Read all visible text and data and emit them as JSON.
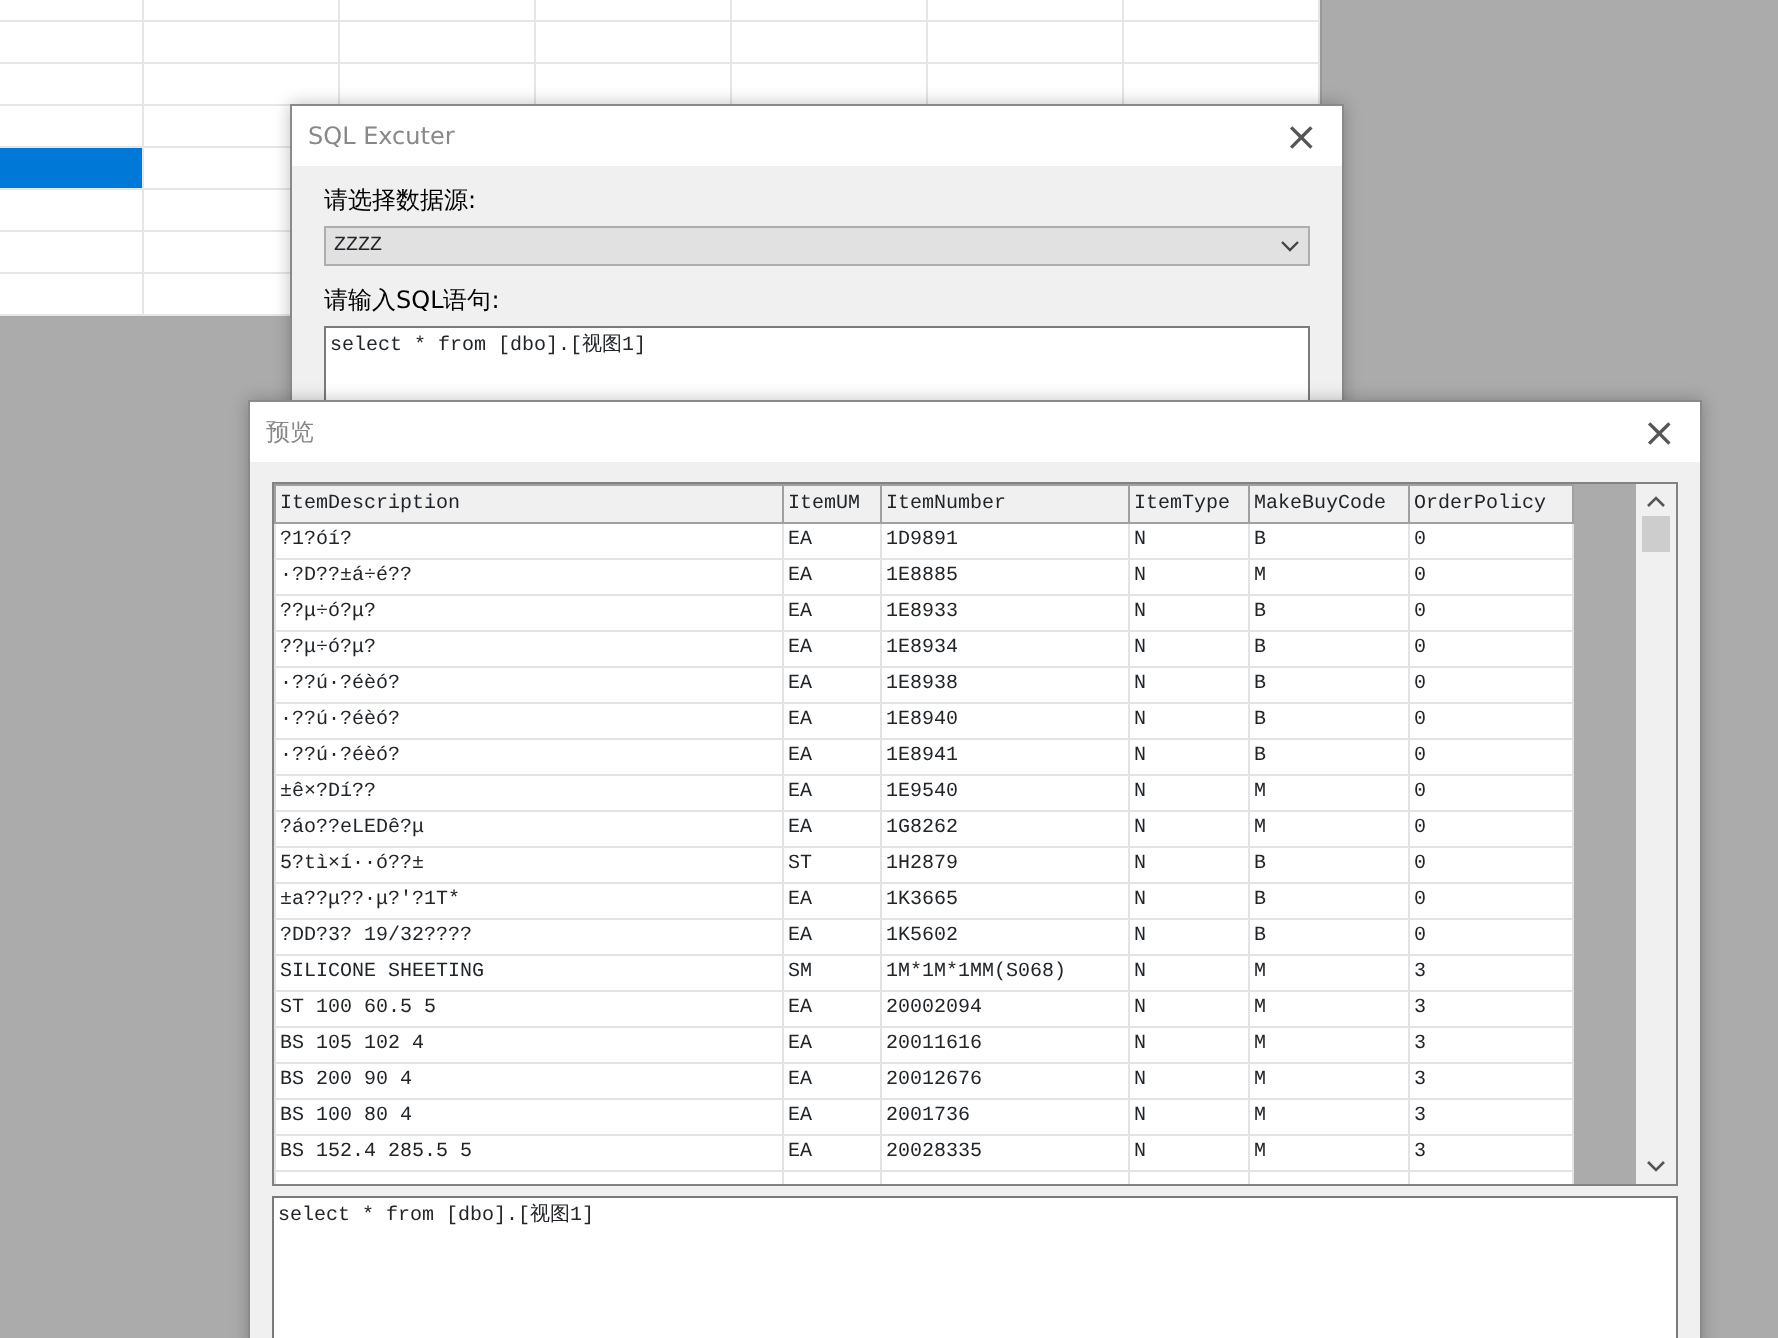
{
  "background_sheet": {
    "rows": [
      {
        "selected": false
      },
      {
        "selected": false
      },
      {
        "selected": false
      },
      {
        "selected": false
      },
      {
        "selected": true
      },
      {
        "selected": false
      },
      {
        "selected": false
      },
      {
        "selected": false
      }
    ]
  },
  "sql_dialog": {
    "title": "SQL Excuter",
    "close": "×",
    "source_label": "请选择数据源:",
    "source_value": "ZZZZ",
    "sql_label": "请输入SQL语句:",
    "sql_text": "select * from [dbo].[视图1]"
  },
  "preview_window": {
    "title": "预览",
    "close": "×",
    "table": {
      "columns": [
        "ItemDescription",
        "ItemUM",
        "ItemNumber",
        "ItemType",
        "MakeBuyCode",
        "OrderPolicy"
      ],
      "rows": [
        [
          "?1?óí?",
          "EA",
          "1D9891",
          "N",
          "B",
          "0"
        ],
        [
          "·?D??±á÷é??",
          "EA",
          "1E8885",
          "N",
          "M",
          "0"
        ],
        [
          "??μ÷ó?μ?",
          "EA",
          "1E8933",
          "N",
          "B",
          "0"
        ],
        [
          "??μ÷ó?μ?",
          "EA",
          "1E8934",
          "N",
          "B",
          "0"
        ],
        [
          "·??ú·?éèó?",
          "EA",
          "1E8938",
          "N",
          "B",
          "0"
        ],
        [
          "·??ú·?éèó?",
          "EA",
          "1E8940",
          "N",
          "B",
          "0"
        ],
        [
          "·??ú·?éèó?",
          "EA",
          "1E8941",
          "N",
          "B",
          "0"
        ],
        [
          "±ê×?Dí??",
          "EA",
          "1E9540",
          "N",
          "M",
          "0"
        ],
        [
          "?áo??eLEDê?μ",
          "EA",
          "1G8262",
          "N",
          "M",
          "0"
        ],
        [
          "5?tì×í··ó??±",
          "ST",
          "1H2879",
          "N",
          "B",
          "0"
        ],
        [
          "±a??μ??·μ?′?1T*",
          "EA",
          "1K3665",
          "N",
          "B",
          "0"
        ],
        [
          "?DD?3? 19/32????",
          "EA",
          "1K5602",
          "N",
          "B",
          "0"
        ],
        [
          "SILICONE SHEETING",
          "SM",
          "1M*1M*1MM(S068)",
          "N",
          "M",
          "3"
        ],
        [
          "ST 100 60.5 5",
          "EA",
          "20002094",
          "N",
          "M",
          "3"
        ],
        [
          "BS 105 102 4",
          "EA",
          "20011616",
          "N",
          "M",
          "3"
        ],
        [
          "BS 200 90 4",
          "EA",
          "20012676",
          "N",
          "M",
          "3"
        ],
        [
          "BS 100 80 4",
          "EA",
          "2001736",
          "N",
          "M",
          "3"
        ],
        [
          "BS 152.4 285.5 5",
          "EA",
          "20028335",
          "N",
          "M",
          "3"
        ]
      ]
    },
    "sql_text": "select * from [dbo].[视图1]"
  }
}
